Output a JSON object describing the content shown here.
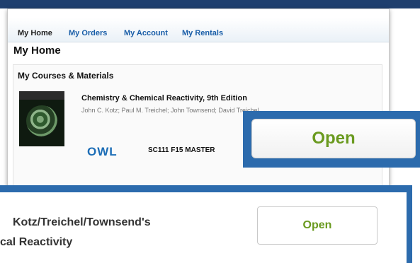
{
  "nav": {
    "home": "My Home",
    "orders": "My Orders",
    "account": "My Account",
    "rentals": "My Rentals"
  },
  "page_title": "My Home",
  "courses": {
    "heading": "My Courses & Materials",
    "book_title": "Chemistry & Chemical Reactivity, 9th Edition",
    "book_authors": "John C. Kotz; Paul M. Treichel; John Townsend; David Treichel",
    "platform_logo": "OWL",
    "course_code": "SC111 F15 MASTER",
    "open_label": "Open"
  },
  "bottom": {
    "title_line1": "Kotz/Treichel/Townsend's",
    "title_line2": "cal Reactivity",
    "open_label": "Open"
  },
  "colors": {
    "accent_blue": "#2c6bad",
    "link_blue": "#1a5ea8",
    "open_green": "#6a9a1f",
    "header_navy": "#1f3f6e"
  }
}
